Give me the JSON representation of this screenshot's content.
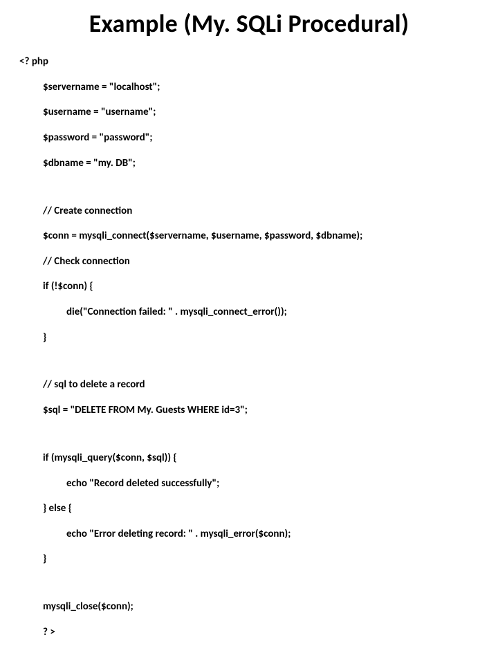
{
  "title": "Example (My. SQLi Procedural)",
  "code": {
    "l01": "<? php",
    "l02": "$servername = \"localhost\";",
    "l03": "$username = \"username\";",
    "l04": "$password = \"password\";",
    "l05": "$dbname = \"my. DB\";",
    "l06": "// Create connection",
    "l07": "$conn = mysqli_connect($servername, $username, $password, $dbname);",
    "l08": "// Check connection",
    "l09": "if (!$conn) {",
    "l10": "die(\"Connection failed: \" . mysqli_connect_error());",
    "l11": "}",
    "l12": "// sql to delete a record",
    "l13": "$sql = \"DELETE FROM My. Guests WHERE id=3\";",
    "l14": "if (mysqli_query($conn, $sql)) {",
    "l15": "echo \"Record deleted successfully\";",
    "l16": "} else {",
    "l17": "echo \"Error deleting record: \" . mysqli_error($conn);",
    "l18": "}",
    "l19": "mysqli_close($conn);",
    "l20": "? >"
  }
}
